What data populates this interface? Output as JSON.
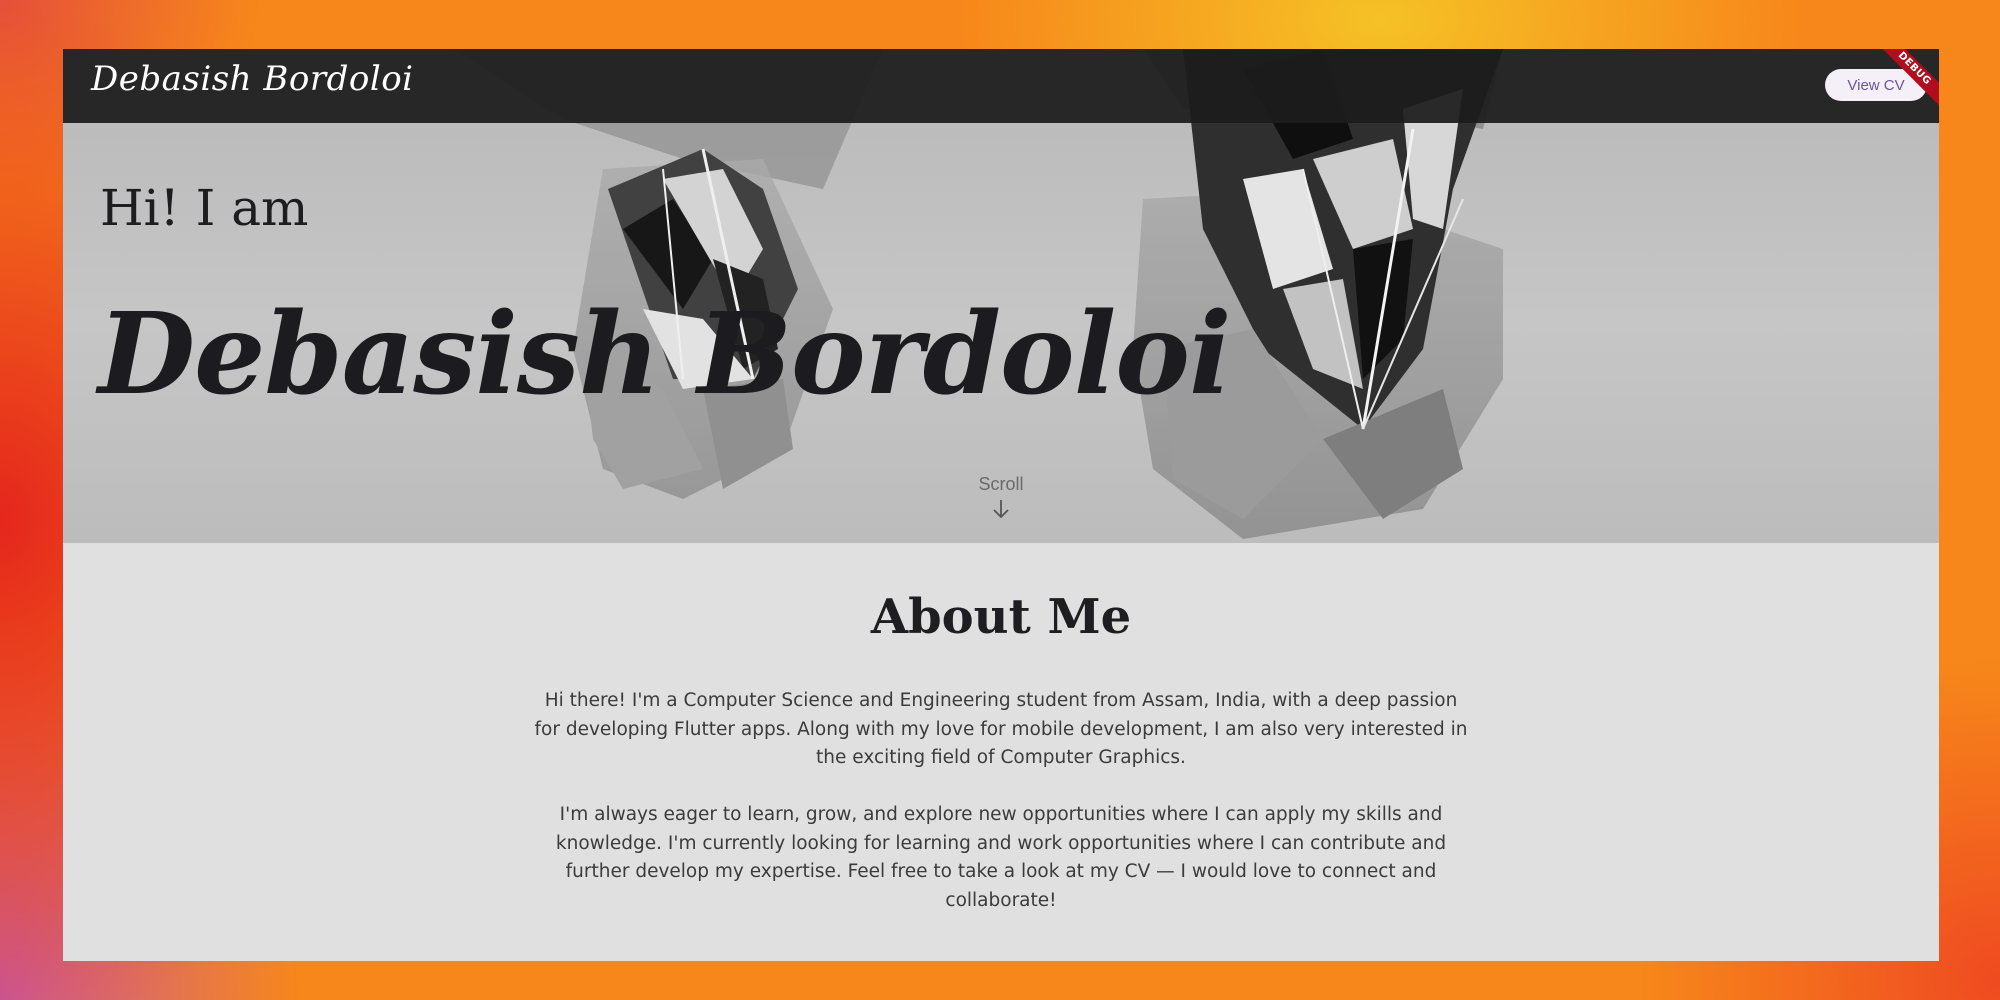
{
  "appbar": {
    "brand": "Debasish Bordoloi",
    "cv_button_label": "View CV",
    "debug_banner": "DEBUG"
  },
  "hero": {
    "greeting": "Hi! I am",
    "name": "Debasish Bordoloi",
    "scroll_label": "Scroll",
    "background_image": "grayscale-crystal-diamonds"
  },
  "about": {
    "title": "About Me",
    "paragraph_1": "Hi there! I'm a Computer Science and Engineering student from Assam, India, with a deep passion for developing Flutter apps. Along with my love for mobile development, I am also very interested in the exciting field of Computer Graphics.",
    "paragraph_2": "I'm always eager to learn, grow, and explore new opportunities where I can apply my skills and knowledge. I'm currently looking for learning and work opportunities where I can contribute and further develop my expertise. Feel free to take a look at my CV — I would love to connect and collaborate!"
  },
  "colors": {
    "appbar_background": "#1c1c1c",
    "accent_button_text": "#6a5596",
    "page_background": "#e0e0e0",
    "text_dark": "#1c1c20"
  },
  "icons": {
    "scroll": "arrow-down-icon"
  }
}
